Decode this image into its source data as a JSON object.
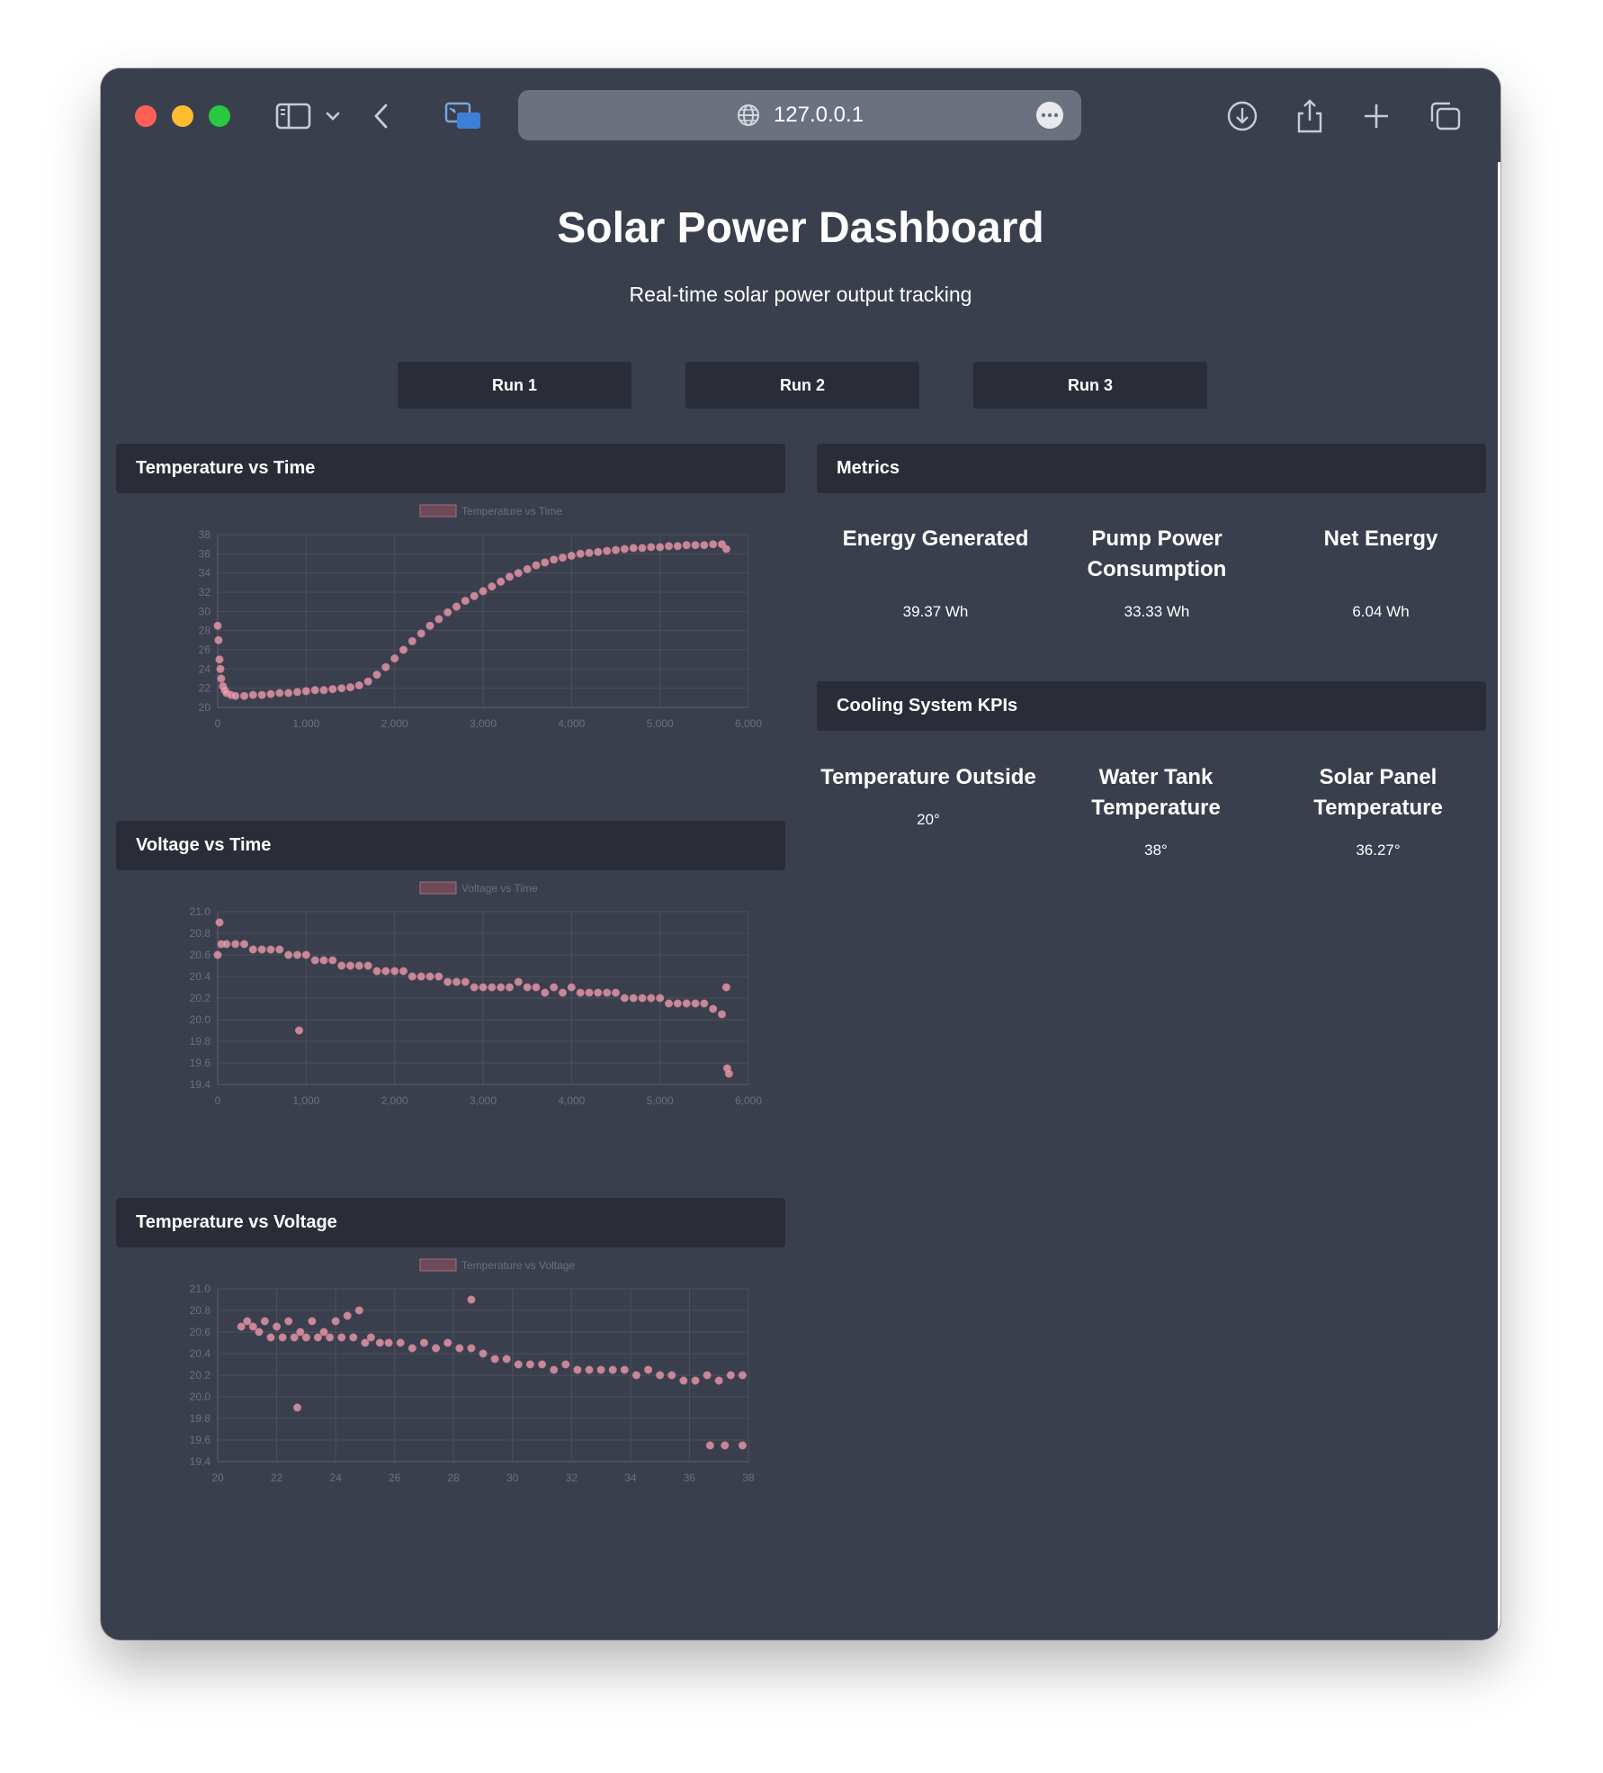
{
  "browser": {
    "url": "127.0.0.1"
  },
  "page": {
    "title": "Solar Power Dashboard",
    "subtitle": "Real-time solar power output tracking",
    "runs": [
      "Run 1",
      "Run 2",
      "Run 3"
    ]
  },
  "panels": {
    "temp_time": "Temperature vs Time",
    "volt_time": "Voltage vs Time",
    "temp_volt": "Temperature vs Voltage",
    "metrics": "Metrics",
    "cooling": "Cooling System KPIs"
  },
  "metrics": [
    {
      "label": "Energy Generated",
      "value": "39.37 Wh"
    },
    {
      "label": "Pump Power Consumption",
      "value": "33.33 Wh"
    },
    {
      "label": "Net Energy",
      "value": "6.04 Wh"
    }
  ],
  "cooling": [
    {
      "label": "Temperature Outside",
      "value": "20°"
    },
    {
      "label": "Water Tank Temperature",
      "value": "38°"
    },
    {
      "label": "Solar Panel Temperature",
      "value": "36.27°"
    }
  ],
  "colors": {
    "point_fill": "#f4a3b4",
    "point_stroke": "#c97d90",
    "grid": "#4a4f5c",
    "tick": "#6b7080"
  },
  "chart_data": [
    {
      "type": "scatter",
      "legend": "Temperature vs Time",
      "xlim": [
        0,
        6000
      ],
      "ylim": [
        20,
        38
      ],
      "xticks": [
        "0",
        "1,000",
        "2,000",
        "3,000",
        "4,000",
        "5,000",
        "6,000"
      ],
      "yticks": [
        "20",
        "22",
        "24",
        "26",
        "28",
        "30",
        "32",
        "34",
        "36",
        "38"
      ],
      "series": [
        {
          "x": [
            0,
            10,
            20,
            30,
            40,
            60,
            80,
            100,
            150,
            200,
            300,
            400,
            500,
            600,
            700,
            800,
            900,
            1000,
            1100,
            1200,
            1300,
            1400,
            1500,
            1600,
            1700,
            1800,
            1900,
            2000,
            2100,
            2200,
            2300,
            2400,
            2500,
            2600,
            2700,
            2800,
            2900,
            3000,
            3100,
            3200,
            3300,
            3400,
            3500,
            3600,
            3700,
            3800,
            3900,
            4000,
            4100,
            4200,
            4300,
            4400,
            4500,
            4600,
            4700,
            4800,
            4900,
            5000,
            5100,
            5200,
            5300,
            5400,
            5500,
            5600,
            5700,
            5750
          ],
          "y": [
            28.5,
            27,
            25,
            24,
            23,
            22.2,
            21.8,
            21.5,
            21.3,
            21.2,
            21.2,
            21.3,
            21.3,
            21.4,
            21.5,
            21.5,
            21.6,
            21.7,
            21.8,
            21.8,
            21.9,
            22.0,
            22.1,
            22.3,
            22.7,
            23.4,
            24.2,
            25.1,
            26.0,
            26.9,
            27.7,
            28.5,
            29.2,
            29.9,
            30.5,
            31.1,
            31.6,
            32.1,
            32.6,
            33.1,
            33.6,
            34.0,
            34.4,
            34.8,
            35.1,
            35.4,
            35.6,
            35.8,
            36.0,
            36.1,
            36.2,
            36.3,
            36.4,
            36.5,
            36.6,
            36.6,
            36.7,
            36.7,
            36.8,
            36.8,
            36.9,
            36.9,
            36.9,
            37.0,
            37.0,
            36.5
          ]
        }
      ]
    },
    {
      "type": "scatter",
      "legend": "Voltage vs Time",
      "xlim": [
        0,
        6000
      ],
      "ylim": [
        19.4,
        21.0
      ],
      "xticks": [
        "0",
        "1,000",
        "2,000",
        "3,000",
        "4,000",
        "5,000",
        "6,000"
      ],
      "yticks": [
        "19.4",
        "19.6",
        "19.8",
        "20.0",
        "20.2",
        "20.4",
        "20.6",
        "20.8",
        "21.0"
      ],
      "series": [
        {
          "x": [
            0,
            20,
            40,
            100,
            200,
            300,
            400,
            500,
            600,
            700,
            800,
            900,
            920,
            1000,
            1100,
            1200,
            1300,
            1400,
            1500,
            1600,
            1700,
            1800,
            1900,
            2000,
            2100,
            2200,
            2300,
            2400,
            2500,
            2600,
            2700,
            2800,
            2900,
            3000,
            3100,
            3200,
            3300,
            3400,
            3500,
            3600,
            3700,
            3800,
            3900,
            4000,
            4100,
            4200,
            4300,
            4400,
            4500,
            4600,
            4700,
            4800,
            4900,
            5000,
            5100,
            5200,
            5300,
            5400,
            5500,
            5600,
            5700,
            5750,
            5760,
            5780
          ],
          "y": [
            20.6,
            20.9,
            20.7,
            20.7,
            20.7,
            20.7,
            20.65,
            20.65,
            20.65,
            20.65,
            20.6,
            20.6,
            19.9,
            20.6,
            20.55,
            20.55,
            20.55,
            20.5,
            20.5,
            20.5,
            20.5,
            20.45,
            20.45,
            20.45,
            20.45,
            20.4,
            20.4,
            20.4,
            20.4,
            20.35,
            20.35,
            20.35,
            20.3,
            20.3,
            20.3,
            20.3,
            20.3,
            20.35,
            20.3,
            20.3,
            20.25,
            20.3,
            20.25,
            20.3,
            20.25,
            20.25,
            20.25,
            20.25,
            20.25,
            20.2,
            20.2,
            20.2,
            20.2,
            20.2,
            20.15,
            20.15,
            20.15,
            20.15,
            20.15,
            20.1,
            20.05,
            20.3,
            19.55,
            19.5
          ]
        }
      ]
    },
    {
      "type": "scatter",
      "legend": "Temperature vs Voltage",
      "xlim": [
        20,
        38
      ],
      "ylim": [
        19.4,
        21.0
      ],
      "xticks": [
        "20",
        "22",
        "24",
        "26",
        "28",
        "30",
        "32",
        "34",
        "36",
        "38"
      ],
      "yticks": [
        "19.4",
        "19.6",
        "19.8",
        "20.0",
        "20.2",
        "20.4",
        "20.6",
        "20.8",
        "21.0"
      ],
      "series": [
        {
          "x": [
            20.8,
            21.0,
            21.2,
            21.4,
            21.6,
            21.8,
            22.0,
            22.2,
            22.4,
            22.6,
            22.8,
            23.0,
            23.2,
            23.4,
            23.6,
            23.8,
            24.0,
            24.2,
            24.4,
            24.6,
            24.8,
            25.0,
            25.2,
            25.5,
            25.8,
            26.2,
            26.6,
            27.0,
            27.4,
            27.8,
            28.2,
            28.6,
            29.0,
            29.4,
            29.8,
            30.2,
            30.6,
            31.0,
            31.4,
            31.8,
            32.2,
            32.6,
            33.0,
            33.4,
            33.8,
            34.2,
            34.6,
            35.0,
            35.4,
            35.8,
            36.2,
            36.6,
            37.0,
            37.4,
            37.8,
            22.7,
            28.6,
            36.7,
            37.2,
            37.8
          ],
          "y": [
            20.65,
            20.7,
            20.65,
            20.6,
            20.7,
            20.55,
            20.65,
            20.55,
            20.7,
            20.55,
            20.6,
            20.55,
            20.7,
            20.55,
            20.6,
            20.55,
            20.7,
            20.55,
            20.75,
            20.55,
            20.8,
            20.5,
            20.55,
            20.5,
            20.5,
            20.5,
            20.45,
            20.5,
            20.45,
            20.5,
            20.45,
            20.45,
            20.4,
            20.35,
            20.35,
            20.3,
            20.3,
            20.3,
            20.25,
            20.3,
            20.25,
            20.25,
            20.25,
            20.25,
            20.25,
            20.2,
            20.25,
            20.2,
            20.2,
            20.15,
            20.15,
            20.2,
            20.15,
            20.2,
            20.2,
            19.9,
            20.9,
            19.55,
            19.55,
            19.55
          ]
        }
      ]
    }
  ]
}
